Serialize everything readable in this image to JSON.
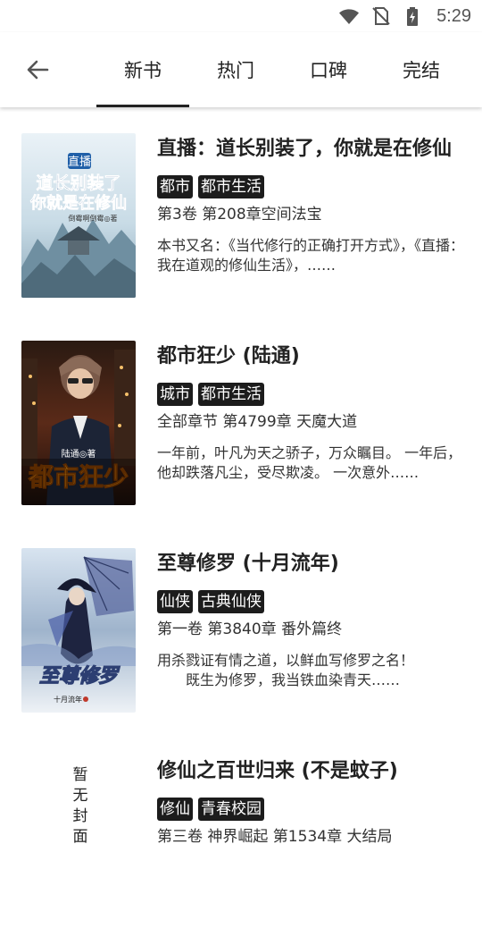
{
  "status_bar": {
    "time": "5:29",
    "icons": [
      "wifi-icon",
      "no-sim-icon",
      "battery-charging-icon"
    ]
  },
  "header": {
    "back_icon": "arrow-left-icon",
    "tabs": [
      {
        "label": "新书",
        "active": true
      },
      {
        "label": "热门",
        "active": false
      },
      {
        "label": "口碑",
        "active": false
      },
      {
        "label": "完结",
        "active": false
      }
    ]
  },
  "books": [
    {
      "title": "直播：道长别装了，你就是在修仙",
      "tags": [
        "都市",
        "都市生活"
      ],
      "chapter": "第3卷 第208章空间法宝",
      "description": "本书又名：《当代修行的正确打开方式》，《直播：我在道观的修仙生活》，……",
      "cover": {
        "line1": "直播",
        "line2": "道长别装了",
        "line3": "你就是在修仙",
        "author": "倒霉啊倒霉◎著"
      }
    },
    {
      "title": "都市狂少 (陆通)",
      "tags": [
        "城市",
        "都市生活"
      ],
      "chapter": "全部章节 第4799章  天魔大道",
      "description": "一年前，叶凡为天之骄子，万众瞩目。 一年后，他却跌落凡尘，受尽欺凌。 一次意外……",
      "cover": {
        "title": "都市狂少",
        "author": "陆通◎著"
      }
    },
    {
      "title": "至尊修罗 (十月流年)",
      "tags": [
        "仙侠",
        "古典仙侠"
      ],
      "chapter": "第一卷 第3840章 番外篇终",
      "description": "用杀戮证有情之道，以鲜血写修罗之名！\n　　既生为修罗，我当铁血染青天……",
      "cover": {
        "title": "至尊修罗",
        "author": "十月流年"
      }
    },
    {
      "title": "修仙之百世归来 (不是蚊子)",
      "tags": [
        "修仙",
        "青春校园"
      ],
      "chapter": "第三卷 神界崛起 第1534章  大结局",
      "description": "",
      "cover": {
        "placeholder": "暂无封面"
      }
    }
  ]
}
